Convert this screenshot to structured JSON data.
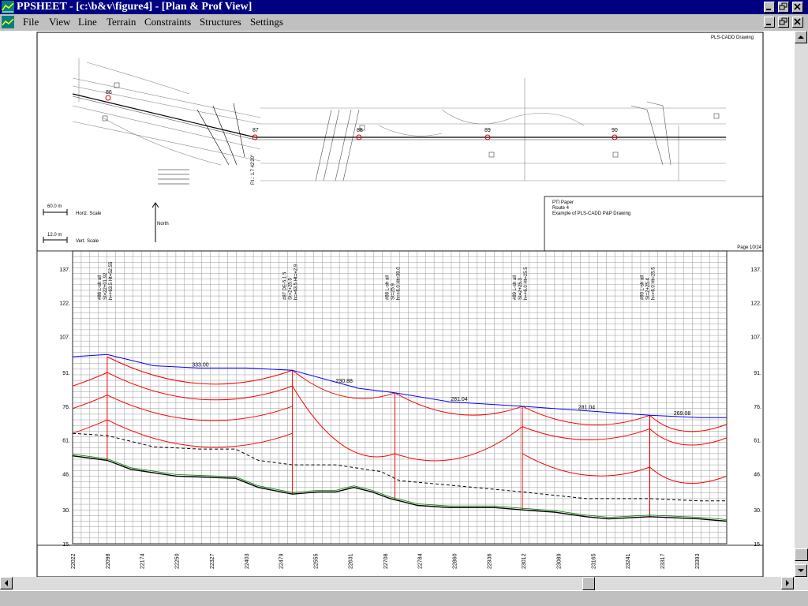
{
  "window": {
    "title": "PPSHEET - [c:\\b&v\\figure4] - [Plan & Prof View]"
  },
  "menu": {
    "items": [
      "File",
      "View",
      "Line",
      "Terrain",
      "Constraints",
      "Structures",
      "Settings"
    ]
  },
  "plan": {
    "drawing_tag": "PLS-CADD Drawing",
    "structure_numbers": [
      "86",
      "87",
      "88",
      "89",
      "90"
    ],
    "horiz_scale_value": "60.0 m",
    "horiz_scale_label": "Horiz. Scale",
    "vert_scale_value": "12.0 m",
    "vert_scale_label": "Vert. Scale",
    "north_label": "North",
    "title_block": {
      "line1": "PTI Paper",
      "line2": "Route 4",
      "line3": "Example of PLS-CADD P&P Drawing"
    },
    "page": "Page 10/24",
    "pi_label": "P.I.: 1.7 42'20\""
  },
  "chart_data": {
    "type": "line",
    "title": "",
    "xlabel": "",
    "ylabel": "",
    "ylim": [
      15,
      145
    ],
    "y_ticks": [
      15,
      30,
      46,
      61,
      76,
      91,
      107,
      122,
      137
    ],
    "y_tick_labels": [
      "15.",
      "30.",
      "46.",
      "61.",
      "76.",
      "91.",
      "107.",
      "122.",
      "137."
    ],
    "xlim": [
      22022,
      23459
    ],
    "x_ticks": [
      22022,
      22098,
      22174,
      22250,
      22327,
      22403,
      22479,
      22555,
      22631,
      22708,
      22784,
      22860,
      22936,
      23012,
      23089,
      23165,
      23241,
      23317,
      23393
    ],
    "x_tick_labels": [
      "22022",
      "22098",
      "22174",
      "22250",
      "22327",
      "22403",
      "22479",
      "22555",
      "22631",
      "22708",
      "22784",
      "22860",
      "22936",
      "23012",
      "23089",
      "23165",
      "23241",
      "23317",
      "23393"
    ],
    "structures": [
      {
        "num": "86",
        "station": 22098,
        "label1": "#86 L-sh all",
        "label2": "St=22+01.92",
        "label3": "h=+63.5 Ht=52.55",
        "base_y": 52,
        "attach_y": [
          98,
          91,
          81,
          70
        ]
      },
      {
        "num": "87",
        "station": 22505,
        "label1": "#87 DE-5.1 5",
        "label2": "St=2+25.5",
        "label3": "h=+63.5 Ht=+2.9",
        "base_y": 37,
        "attach_y": [
          92,
          85,
          76,
          64
        ]
      },
      {
        "num": "88",
        "station": 22730,
        "label1": "#88 L-sh all",
        "label2": "St=25.9",
        "label3": "h=+6.0 Ht=39.0",
        "base_y": 35,
        "attach_y": [
          82,
          55
        ]
      },
      {
        "num": "89",
        "station": 23010,
        "label1": "#89 L-sh all",
        "label2": "St=2+25.3",
        "label3": "h=+6.0 Ht=25.5",
        "base_y": 30,
        "attach_y": [
          76,
          67,
          55
        ]
      },
      {
        "num": "90",
        "station": 23290,
        "label1": "#90 L-sh all",
        "label2": "St=2+25.4",
        "label3": "h=+6.0 Ht=25.5",
        "base_y": 27,
        "attach_y": [
          72,
          66,
          49
        ]
      }
    ],
    "series": [
      {
        "name": "",
        "kind": "shield",
        "color": "#0000ff",
        "points": [
          [
            22022,
            98
          ],
          [
            22098,
            99
          ],
          [
            22200,
            94
          ],
          [
            22300,
            93
          ],
          [
            22403,
            93
          ],
          [
            22505,
            92
          ],
          [
            22650,
            84
          ],
          [
            22730,
            82
          ],
          [
            22850,
            78
          ],
          [
            23010,
            76
          ],
          [
            23150,
            74
          ],
          [
            23290,
            72
          ],
          [
            23400,
            71
          ],
          [
            23459,
            71
          ]
        ]
      },
      {
        "name": "",
        "kind": "ground",
        "color": "#000000",
        "points": [
          [
            22022,
            54
          ],
          [
            22098,
            52
          ],
          [
            22150,
            48
          ],
          [
            22250,
            45
          ],
          [
            22380,
            44
          ],
          [
            22430,
            40
          ],
          [
            22505,
            37
          ],
          [
            22560,
            38
          ],
          [
            22600,
            38
          ],
          [
            22640,
            40
          ],
          [
            22680,
            38
          ],
          [
            22720,
            35
          ],
          [
            22780,
            32
          ],
          [
            22850,
            31
          ],
          [
            22950,
            31
          ],
          [
            23010,
            30
          ],
          [
            23080,
            29
          ],
          [
            23150,
            27
          ],
          [
            23200,
            26
          ],
          [
            23290,
            27
          ],
          [
            23400,
            26
          ],
          [
            23459,
            25
          ]
        ]
      },
      {
        "name": "",
        "kind": "ground-offset",
        "color": "#000000",
        "dashed": true,
        "points": [
          [
            22022,
            64
          ],
          [
            22098,
            63
          ],
          [
            22200,
            58
          ],
          [
            22300,
            57
          ],
          [
            22380,
            57
          ],
          [
            22430,
            52
          ],
          [
            22505,
            50
          ],
          [
            22600,
            50
          ],
          [
            22700,
            47
          ],
          [
            22740,
            43
          ],
          [
            22850,
            41
          ],
          [
            23010,
            38
          ],
          [
            23150,
            35
          ],
          [
            23290,
            35
          ],
          [
            23400,
            34
          ],
          [
            23459,
            34
          ]
        ]
      }
    ],
    "span_labels": [
      "333.00",
      "230.88",
      "281.04",
      "281.04",
      "269.08"
    ]
  }
}
